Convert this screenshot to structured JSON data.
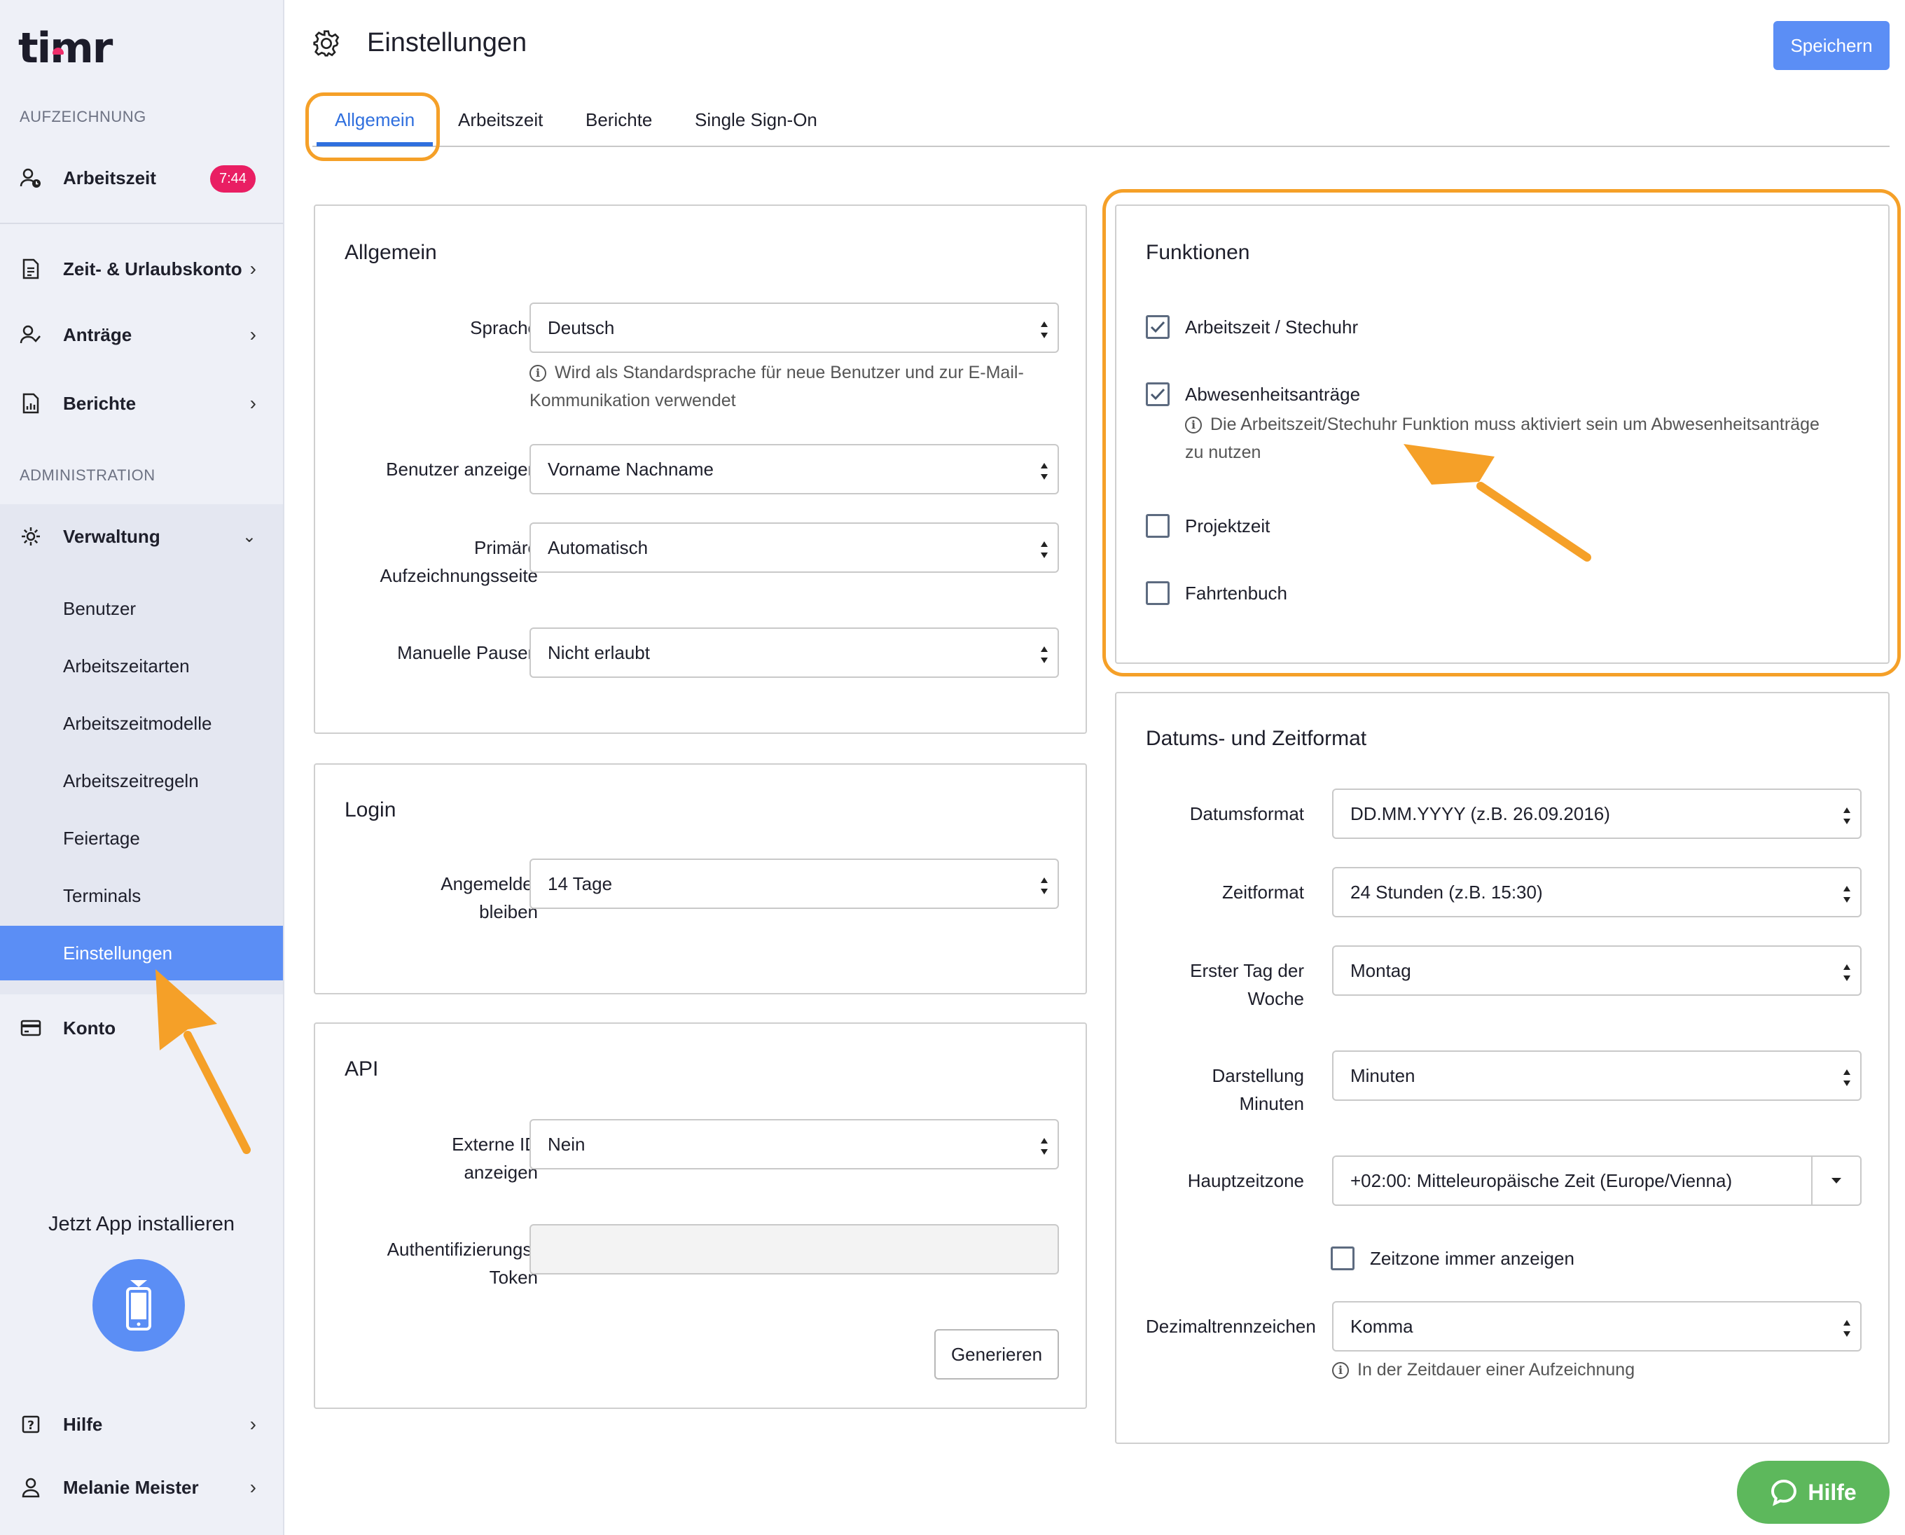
{
  "app": {
    "logo": "timr"
  },
  "sidebar": {
    "section_recording": "AUFZEICHNUNG",
    "worktime": {
      "label": "Arbeitszeit",
      "badge": "7:44"
    },
    "items": [
      {
        "label": "Zeit- & Urlaubskonto",
        "icon": "document-icon"
      },
      {
        "label": "Anträge",
        "icon": "user-check-icon"
      },
      {
        "label": "Berichte",
        "icon": "report-icon"
      }
    ],
    "section_admin": "ADMINISTRATION",
    "admin": {
      "label": "Verwaltung",
      "icon": "gear-icon"
    },
    "admin_sub": [
      "Benutzer",
      "Arbeitszeitarten",
      "Arbeitszeitmodelle",
      "Arbeitszeitregeln",
      "Feiertage",
      "Terminals",
      "Einstellungen"
    ],
    "account": {
      "label": "Konto",
      "icon": "credit-card-icon"
    },
    "app_install": "Jetzt App installieren",
    "help": "Hilfe",
    "user": "Melanie Meister"
  },
  "header": {
    "title": "Einstellungen",
    "save_label": "Speichern"
  },
  "tabs": [
    {
      "label": "Allgemein",
      "active": true
    },
    {
      "label": "Arbeitszeit"
    },
    {
      "label": "Berichte"
    },
    {
      "label": "Single Sign-On"
    }
  ],
  "general": {
    "title": "Allgemein",
    "language_label": "Sprache",
    "language_value": "Deutsch",
    "language_help": "Wird als Standardsprache für neue Benutzer und zur E-Mail-Kommunikation verwendet",
    "show_users_label": "Benutzer anzeigen",
    "show_users_value": "Vorname Nachname",
    "primary_page_label_1": "Primäre",
    "primary_page_label_2": "Aufzeichnungsseite",
    "primary_page_value": "Automatisch",
    "manual_breaks_label": "Manuelle Pausen",
    "manual_breaks_value": "Nicht erlaubt"
  },
  "login": {
    "title": "Login",
    "stay_label_1": "Angemeldet",
    "stay_label_2": "bleiben",
    "stay_value": "14 Tage"
  },
  "api": {
    "title": "API",
    "external_id_label_1": "Externe ID",
    "external_id_label_2": "anzeigen",
    "external_id_value": "Nein",
    "token_label_1": "Authentifizierungs-",
    "token_label_2": "Token",
    "token_value": "",
    "generate_label": "Generieren"
  },
  "functions": {
    "title": "Funktionen",
    "items": [
      {
        "label": "Arbeitszeit / Stechuhr",
        "checked": true
      },
      {
        "label": "Abwesenheitsanträge",
        "checked": true
      },
      {
        "label": "Projektzeit",
        "checked": false
      },
      {
        "label": "Fahrtenbuch",
        "checked": false
      }
    ],
    "absence_help_1": "Die Arbeitszeit/Stechuhr Funktion muss aktiviert sein um Abwesenheitsanträge",
    "absence_help_2": "zu nutzen"
  },
  "datetime": {
    "title": "Datums- und Zeitformat",
    "date_format_label": "Datumsformat",
    "date_format_value": "DD.MM.YYYY (z.B. 26.09.2016)",
    "time_format_label": "Zeitformat",
    "time_format_value": "24 Stunden (z.B. 15:30)",
    "first_day_label_1": "Erster Tag der",
    "first_day_label_2": "Woche",
    "first_day_value": "Montag",
    "minutes_label_1": "Darstellung",
    "minutes_label_2": "Minuten",
    "minutes_value": "Minuten",
    "timezone_label": "Hauptzeitzone",
    "timezone_value": "+02:00: Mitteleuropäische Zeit (Europe/Vienna)",
    "always_show_tz_label": "Zeitzone immer anzeigen",
    "always_show_tz_checked": false,
    "decimal_label": "Dezimaltrennzeichen",
    "decimal_value": "Komma",
    "decimal_help": "In der Zeitdauer einer Aufzeichnung"
  },
  "fab": {
    "label": "Hilfe"
  },
  "colors": {
    "accent": "#5b8ef5",
    "badge": "#e91e63",
    "highlight": "#f5a028",
    "fab": "#5db85c",
    "active_tab": "#2f6fde"
  }
}
